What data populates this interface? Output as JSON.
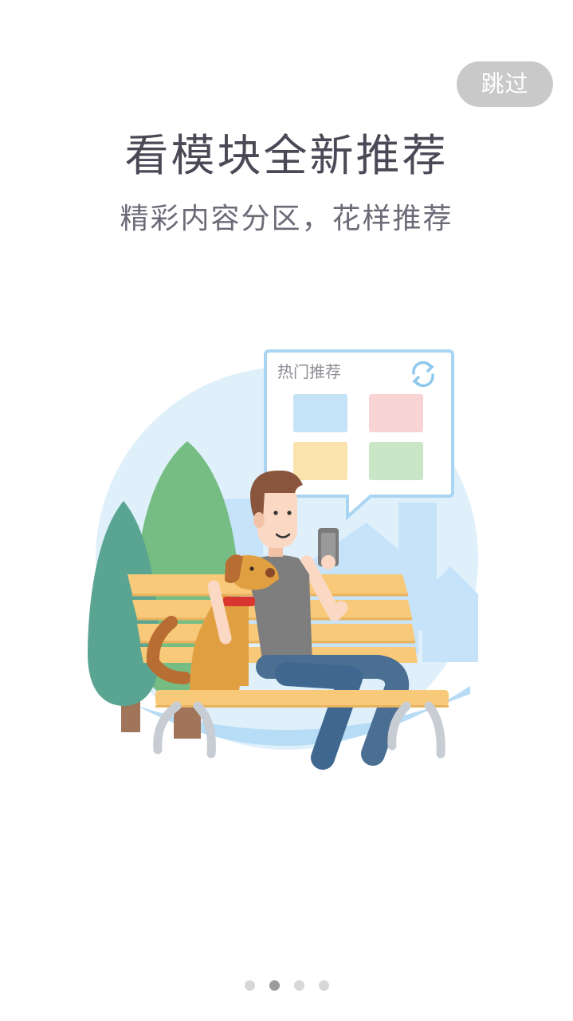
{
  "skip_button": {
    "label": "跳过"
  },
  "onboarding": {
    "title": "看模块全新推荐",
    "subtitle": "精彩内容分区，花样推荐"
  },
  "illustration": {
    "card_title": "热门推荐",
    "card_icon": "refresh-icon",
    "tile_colors": [
      "#c5e3f7",
      "#f9d4d4",
      "#fae3ad",
      "#c9e6c6"
    ]
  },
  "pagination": {
    "total_pages": 4,
    "active_page": 2
  },
  "colors": {
    "title_text": "#4a4a57",
    "skip_bg": "#c9c9c9",
    "dot_active": "#9b9b9b",
    "dot_inactive": "#d7d7d7"
  }
}
